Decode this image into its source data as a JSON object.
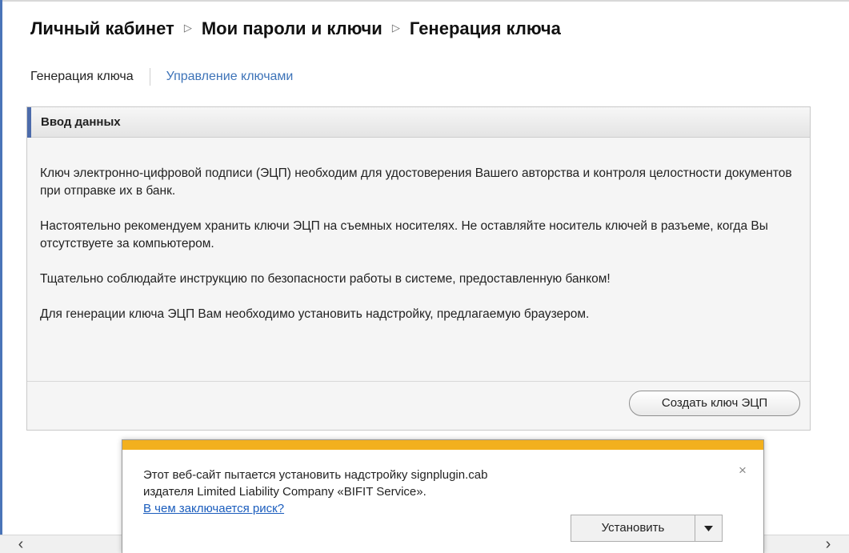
{
  "breadcrumb": {
    "items": [
      "Личный кабинет",
      "Мои пароли и ключи",
      "Генерация ключа"
    ],
    "separator": "▷"
  },
  "tabs": {
    "active": "Генерация ключа",
    "link": "Управление ключами"
  },
  "panel": {
    "title": "Ввод данных",
    "paragraphs": [
      "Ключ электронно-цифровой подписи (ЭЦП) необходим для удостоверения Вашего авторства и контроля целостности документов при отправке их в банк.",
      "Настоятельно рекомендуем хранить ключи ЭЦП на съемных носителях. Не оставляйте носитель ключей в разъеме, когда Вы отсутствуете за компьютером.",
      "Тщательно соблюдайте инструкцию по безопасности работы в системе, предоставленную банком!",
      "Для генерации ключа ЭЦП Вам необходимо установить надстройку, предлагаемую браузером."
    ],
    "create_button": "Создать ключ ЭЦП"
  },
  "infobar": {
    "message": "Этот веб-сайт пытается установить надстройку signplugin.cab издателя Limited Liability Company «BIFIT Service».",
    "risk_link": "В чем заключается риск?",
    "install_button": "Установить",
    "dropdown_icon": "triangle-down",
    "close_icon": "×",
    "accent_color": "#f2b01e"
  },
  "scrollbar": {
    "left_icon": "‹",
    "right_icon": "›"
  },
  "colors": {
    "link": "#3d73b8",
    "header_accent": "#4c6bab",
    "frame": "#4a74b8"
  }
}
